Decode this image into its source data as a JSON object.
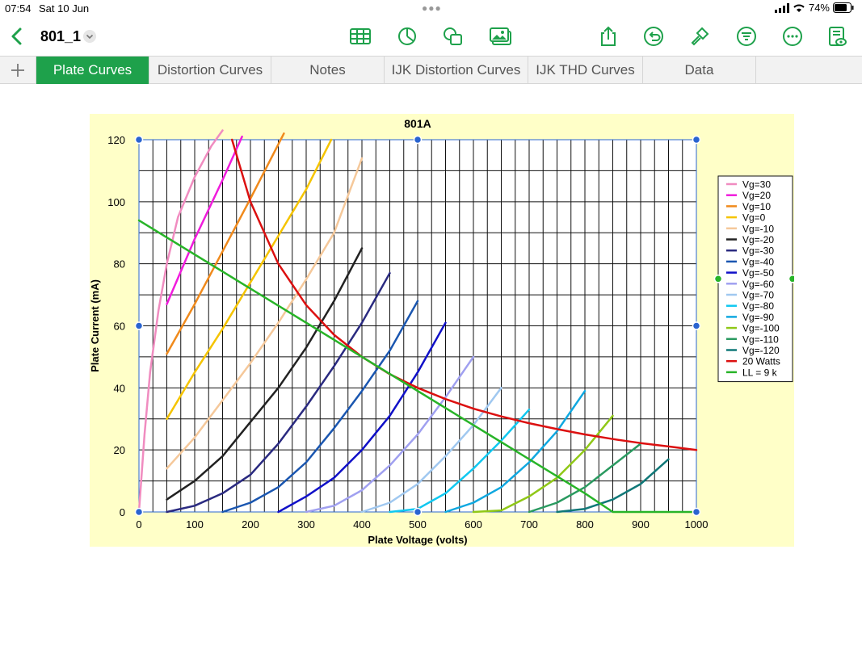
{
  "status": {
    "time": "07:54",
    "date": "Sat 10 Jun",
    "battery": "74%"
  },
  "toolbar": {
    "doc_title": "801_1"
  },
  "tabs": [
    {
      "label": "Plate Curves",
      "active": true
    },
    {
      "label": "Distortion Curves"
    },
    {
      "label": "Notes"
    },
    {
      "label": "IJK Distortion Curves"
    },
    {
      "label": "IJK THD Curves"
    },
    {
      "label": "Data"
    }
  ],
  "colors": {
    "accent": "#1ea14b"
  },
  "chart_data": {
    "type": "line",
    "title": "801A",
    "xlabel": "Plate Voltage (volts)",
    "ylabel": "Plate Current (mA)",
    "xlim": [
      0,
      1000
    ],
    "ylim": [
      0,
      120
    ],
    "xticks": [
      "0",
      "100",
      "200",
      "300",
      "400",
      "500",
      "600",
      "700",
      "800",
      "900",
      "1000"
    ],
    "yticks": [
      "0",
      "20",
      "40",
      "60",
      "80",
      "100",
      "120"
    ],
    "grid": true,
    "legend_position": "right",
    "series": [
      {
        "name": "Vg=30",
        "color": "#f08cc0",
        "points": [
          [
            0,
            0
          ],
          [
            10,
            25
          ],
          [
            20,
            45
          ],
          [
            35,
            65
          ],
          [
            50,
            80
          ],
          [
            70,
            95
          ],
          [
            100,
            108
          ],
          [
            130,
            118
          ],
          [
            150,
            123
          ]
        ]
      },
      {
        "name": "Vg=20",
        "color": "#f01cdc",
        "points": [
          [
            50,
            67
          ],
          [
            100,
            88
          ],
          [
            150,
            107
          ],
          [
            185,
            121
          ]
        ]
      },
      {
        "name": "Vg=10",
        "color": "#f08a1c",
        "points": [
          [
            50,
            51
          ],
          [
            100,
            67
          ],
          [
            150,
            84
          ],
          [
            200,
            101
          ],
          [
            260,
            122
          ]
        ]
      },
      {
        "name": "Vg=0",
        "color": "#f5c400",
        "points": [
          [
            50,
            30
          ],
          [
            100,
            45
          ],
          [
            150,
            59
          ],
          [
            200,
            74
          ],
          [
            250,
            89
          ],
          [
            300,
            104
          ],
          [
            345,
            120
          ]
        ]
      },
      {
        "name": "Vg=-10",
        "color": "#f5c89a",
        "points": [
          [
            50,
            14
          ],
          [
            100,
            24
          ],
          [
            150,
            36
          ],
          [
            200,
            48
          ],
          [
            250,
            61
          ],
          [
            300,
            75
          ],
          [
            350,
            90
          ],
          [
            400,
            114
          ]
        ]
      },
      {
        "name": "Vg=-20",
        "color": "#222222",
        "points": [
          [
            50,
            4
          ],
          [
            100,
            10
          ],
          [
            150,
            18
          ],
          [
            200,
            29
          ],
          [
            250,
            40
          ],
          [
            300,
            53
          ],
          [
            350,
            68
          ],
          [
            400,
            85
          ]
        ]
      },
      {
        "name": "Vg=-30",
        "color": "#2a2a80",
        "points": [
          [
            50,
            0
          ],
          [
            100,
            2
          ],
          [
            150,
            6
          ],
          [
            200,
            12
          ],
          [
            250,
            22
          ],
          [
            300,
            34
          ],
          [
            350,
            47
          ],
          [
            400,
            61
          ],
          [
            450,
            77
          ]
        ]
      },
      {
        "name": "Vg=-40",
        "color": "#1a56b0",
        "points": [
          [
            150,
            0
          ],
          [
            200,
            3
          ],
          [
            250,
            8
          ],
          [
            300,
            16
          ],
          [
            350,
            27
          ],
          [
            400,
            39
          ],
          [
            450,
            52
          ],
          [
            500,
            68
          ]
        ]
      },
      {
        "name": "Vg=-50",
        "color": "#1010c8",
        "points": [
          [
            250,
            0
          ],
          [
            300,
            5
          ],
          [
            350,
            11
          ],
          [
            400,
            20
          ],
          [
            450,
            31
          ],
          [
            500,
            45
          ],
          [
            550,
            61
          ]
        ]
      },
      {
        "name": "Vg=-60",
        "color": "#a0a0f0",
        "points": [
          [
            300,
            0
          ],
          [
            350,
            2
          ],
          [
            400,
            7
          ],
          [
            450,
            15
          ],
          [
            500,
            25
          ],
          [
            550,
            37
          ],
          [
            600,
            50
          ]
        ]
      },
      {
        "name": "Vg=-70",
        "color": "#a0c8f0",
        "points": [
          [
            400,
            0
          ],
          [
            450,
            3
          ],
          [
            500,
            9
          ],
          [
            550,
            18
          ],
          [
            600,
            28
          ],
          [
            650,
            40
          ]
        ]
      },
      {
        "name": "Vg=-80",
        "color": "#10c8f0",
        "points": [
          [
            450,
            0
          ],
          [
            500,
            1
          ],
          [
            550,
            6
          ],
          [
            600,
            14
          ],
          [
            650,
            23
          ],
          [
            700,
            33
          ]
        ]
      },
      {
        "name": "Vg=-90",
        "color": "#10a8e0",
        "points": [
          [
            550,
            0
          ],
          [
            600,
            3
          ],
          [
            650,
            8
          ],
          [
            700,
            16
          ],
          [
            750,
            26
          ],
          [
            800,
            39
          ]
        ]
      },
      {
        "name": "Vg=-100",
        "color": "#90c818",
        "points": [
          [
            600,
            0
          ],
          [
            650,
            0.5
          ],
          [
            700,
            5
          ],
          [
            750,
            11
          ],
          [
            800,
            20
          ],
          [
            850,
            31
          ]
        ]
      },
      {
        "name": "Vg=-110",
        "color": "#2a9a60",
        "points": [
          [
            700,
            0
          ],
          [
            750,
            3
          ],
          [
            800,
            8
          ],
          [
            850,
            15
          ],
          [
            900,
            22
          ]
        ]
      },
      {
        "name": "Vg=-120",
        "color": "#107878",
        "points": [
          [
            750,
            0
          ],
          [
            800,
            1
          ],
          [
            850,
            4
          ],
          [
            900,
            9
          ],
          [
            950,
            17
          ]
        ]
      },
      {
        "name": "20 Watts",
        "color": "#dc1010",
        "points": [
          [
            167,
            120
          ],
          [
            200,
            100
          ],
          [
            250,
            80
          ],
          [
            300,
            66.7
          ],
          [
            350,
            57.1
          ],
          [
            400,
            50
          ],
          [
            450,
            44.4
          ],
          [
            500,
            40
          ],
          [
            550,
            36.4
          ],
          [
            600,
            33.3
          ],
          [
            650,
            30.8
          ],
          [
            700,
            28.6
          ],
          [
            750,
            26.7
          ],
          [
            800,
            25
          ],
          [
            850,
            23.5
          ],
          [
            900,
            22.2
          ],
          [
            950,
            21.1
          ],
          [
            1000,
            20
          ]
        ]
      },
      {
        "name": "LL = 9 k",
        "color": "#28b428",
        "points": [
          [
            0,
            94
          ],
          [
            200,
            72
          ],
          [
            400,
            50
          ],
          [
            600,
            28
          ],
          [
            800,
            6
          ],
          [
            850,
            0
          ],
          [
            1000,
            0
          ]
        ]
      }
    ]
  }
}
